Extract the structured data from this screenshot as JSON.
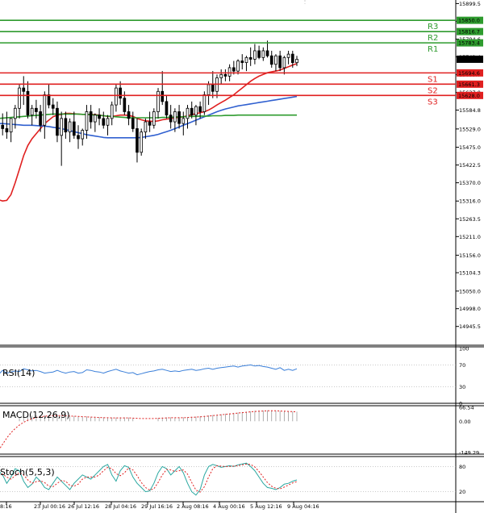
{
  "chart_data": {
    "type": "candlestick",
    "main": {
      "ylim": [
        14890,
        15910
      ],
      "yticks": [
        "15899.5",
        "15847.3",
        "15794.6",
        "15742.4",
        "15689.7",
        "15637.0",
        "15584.8",
        "15529.0",
        "15475.0",
        "15422.5",
        "15370.0",
        "15316.0",
        "15263.5",
        "15211.0",
        "15156.0",
        "15104.3",
        "15050.0",
        "14998.0",
        "14945.5"
      ],
      "price_label": {
        "value": 15735.0,
        "text": "15735.0"
      },
      "levels": [
        {
          "name": "R3",
          "value": 15850.0,
          "text": "15850.0",
          "color": "#2e9b2e"
        },
        {
          "name": "R2",
          "value": 15816.7,
          "text": "15816.7",
          "color": "#2e9b2e"
        },
        {
          "name": "R1",
          "value": 15783.4,
          "text": "15783.4",
          "color": "#2e9b2e"
        },
        {
          "name": "S1",
          "value": 15694.6,
          "text": "15694.6",
          "color": "#e02020"
        },
        {
          "name": "S2",
          "value": 15661.3,
          "text": "15661.3",
          "color": "#e02020"
        },
        {
          "name": "S3",
          "value": 15628.0,
          "text": "15628.0",
          "color": "#e02020"
        }
      ],
      "candles": [
        {
          "o": 15482,
          "h": 15560,
          "l": 15440,
          "c": 15540
        },
        {
          "o": 15540,
          "h": 15575,
          "l": 15510,
          "c": 15530
        },
        {
          "o": 15530,
          "h": 15580,
          "l": 15500,
          "c": 15520
        },
        {
          "o": 15520,
          "h": 15560,
          "l": 15490,
          "c": 15560
        },
        {
          "o": 15560,
          "h": 15600,
          "l": 15530,
          "c": 15590
        },
        {
          "o": 15590,
          "h": 15660,
          "l": 15560,
          "c": 15650
        },
        {
          "o": 15650,
          "h": 15685,
          "l": 15600,
          "c": 15640
        },
        {
          "o": 15640,
          "h": 15670,
          "l": 15560,
          "c": 15570
        },
        {
          "o": 15570,
          "h": 15600,
          "l": 15540,
          "c": 15590
        },
        {
          "o": 15590,
          "h": 15615,
          "l": 15560,
          "c": 15580
        },
        {
          "o": 15580,
          "h": 15600,
          "l": 15520,
          "c": 15540
        },
        {
          "o": 15540,
          "h": 15640,
          "l": 15500,
          "c": 15630
        },
        {
          "o": 15630,
          "h": 15660,
          "l": 15590,
          "c": 15600
        },
        {
          "o": 15600,
          "h": 15620,
          "l": 15570,
          "c": 15590
        },
        {
          "o": 15590,
          "h": 15610,
          "l": 15490,
          "c": 15510
        },
        {
          "o": 15510,
          "h": 15580,
          "l": 15420,
          "c": 15560
        },
        {
          "o": 15560,
          "h": 15580,
          "l": 15500,
          "c": 15520
        },
        {
          "o": 15520,
          "h": 15560,
          "l": 15490,
          "c": 15550
        },
        {
          "o": 15550,
          "h": 15580,
          "l": 15500,
          "c": 15510
        },
        {
          "o": 15510,
          "h": 15540,
          "l": 15470,
          "c": 15500
        },
        {
          "o": 15500,
          "h": 15530,
          "l": 15480,
          "c": 15525
        },
        {
          "o": 15525,
          "h": 15600,
          "l": 15500,
          "c": 15580
        },
        {
          "o": 15580,
          "h": 15600,
          "l": 15530,
          "c": 15550
        },
        {
          "o": 15550,
          "h": 15575,
          "l": 15520,
          "c": 15570
        },
        {
          "o": 15570,
          "h": 15590,
          "l": 15540,
          "c": 15560
        },
        {
          "o": 15560,
          "h": 15580,
          "l": 15530,
          "c": 15540
        },
        {
          "o": 15540,
          "h": 15570,
          "l": 15510,
          "c": 15560
        },
        {
          "o": 15560,
          "h": 15610,
          "l": 15540,
          "c": 15600
        },
        {
          "o": 15600,
          "h": 15660,
          "l": 15580,
          "c": 15650
        },
        {
          "o": 15650,
          "h": 15670,
          "l": 15600,
          "c": 15620
        },
        {
          "o": 15620,
          "h": 15640,
          "l": 15570,
          "c": 15580
        },
        {
          "o": 15580,
          "h": 15600,
          "l": 15540,
          "c": 15560
        },
        {
          "o": 15560,
          "h": 15580,
          "l": 15520,
          "c": 15530
        },
        {
          "o": 15530,
          "h": 15560,
          "l": 15430,
          "c": 15460
        },
        {
          "o": 15460,
          "h": 15530,
          "l": 15450,
          "c": 15520
        },
        {
          "o": 15520,
          "h": 15560,
          "l": 15500,
          "c": 15550
        },
        {
          "o": 15550,
          "h": 15580,
          "l": 15520,
          "c": 15540
        },
        {
          "o": 15540,
          "h": 15590,
          "l": 15530,
          "c": 15580
        },
        {
          "o": 15580,
          "h": 15650,
          "l": 15560,
          "c": 15640
        },
        {
          "o": 15640,
          "h": 15700,
          "l": 15600,
          "c": 15610
        },
        {
          "o": 15610,
          "h": 15630,
          "l": 15560,
          "c": 15570
        },
        {
          "o": 15570,
          "h": 15600,
          "l": 15530,
          "c": 15550
        },
        {
          "o": 15550,
          "h": 15590,
          "l": 15520,
          "c": 15580
        },
        {
          "o": 15580,
          "h": 15600,
          "l": 15530,
          "c": 15545
        },
        {
          "o": 15545,
          "h": 15580,
          "l": 15510,
          "c": 15560
        },
        {
          "o": 15560,
          "h": 15600,
          "l": 15530,
          "c": 15590
        },
        {
          "o": 15590,
          "h": 15610,
          "l": 15560,
          "c": 15570
        },
        {
          "o": 15570,
          "h": 15600,
          "l": 15540,
          "c": 15595
        },
        {
          "o": 15595,
          "h": 15610,
          "l": 15560,
          "c": 15580
        },
        {
          "o": 15580,
          "h": 15640,
          "l": 15570,
          "c": 15630
        },
        {
          "o": 15630,
          "h": 15670,
          "l": 15600,
          "c": 15660
        },
        {
          "o": 15660,
          "h": 15700,
          "l": 15620,
          "c": 15640
        },
        {
          "o": 15640,
          "h": 15690,
          "l": 15620,
          "c": 15680
        },
        {
          "o": 15680,
          "h": 15705,
          "l": 15660,
          "c": 15690
        },
        {
          "o": 15690,
          "h": 15705,
          "l": 15670,
          "c": 15685
        },
        {
          "o": 15685,
          "h": 15720,
          "l": 15670,
          "c": 15710
        },
        {
          "o": 15710,
          "h": 15730,
          "l": 15690,
          "c": 15700
        },
        {
          "o": 15700,
          "h": 15735,
          "l": 15690,
          "c": 15730
        },
        {
          "o": 15730,
          "h": 15750,
          "l": 15705,
          "c": 15725
        },
        {
          "o": 15725,
          "h": 15745,
          "l": 15700,
          "c": 15740
        },
        {
          "o": 15740,
          "h": 15770,
          "l": 15715,
          "c": 15735
        },
        {
          "o": 15735,
          "h": 15780,
          "l": 15720,
          "c": 15760
        },
        {
          "o": 15760,
          "h": 15775,
          "l": 15735,
          "c": 15740
        },
        {
          "o": 15740,
          "h": 15770,
          "l": 15730,
          "c": 15760
        },
        {
          "o": 15760,
          "h": 15790,
          "l": 15740,
          "c": 15745
        },
        {
          "o": 15745,
          "h": 15760,
          "l": 15710,
          "c": 15720
        },
        {
          "o": 15720,
          "h": 15750,
          "l": 15700,
          "c": 15745
        },
        {
          "o": 15745,
          "h": 15760,
          "l": 15700,
          "c": 15710
        },
        {
          "o": 15710,
          "h": 15745,
          "l": 15690,
          "c": 15740
        },
        {
          "o": 15740,
          "h": 15760,
          "l": 15720,
          "c": 15750
        },
        {
          "o": 15750,
          "h": 15760,
          "l": 15710,
          "c": 15725
        },
        {
          "o": 15725,
          "h": 15745,
          "l": 15715,
          "c": 15735
        }
      ],
      "ma_series": [
        {
          "color": "#e02020",
          "values": [
            15320,
            15316,
            15318,
            15335,
            15370,
            15410,
            15450,
            15480,
            15500,
            15515,
            15530,
            15545,
            15555,
            15565,
            15570,
            15572,
            15575,
            15575,
            15574,
            15573,
            15572,
            15572,
            15572,
            15571,
            15570,
            15568,
            15566,
            15566,
            15568,
            15570,
            15570,
            15569,
            15566,
            15560,
            15556,
            15553,
            15552,
            15551,
            15553,
            15556,
            15558,
            15560,
            15562,
            15563,
            15565,
            15568,
            15571,
            15574,
            15577,
            15580,
            15585,
            15592,
            15600,
            15607,
            15614,
            15622,
            15630,
            15640,
            15650,
            15660,
            15670,
            15678,
            15685,
            15690,
            15695,
            15698,
            15700,
            15703,
            15708,
            15713,
            15718,
            15722
          ]
        },
        {
          "color": "#3060d0",
          "values": [
            15545,
            15545,
            15544,
            15543,
            15542,
            15541,
            15540,
            15540,
            15540,
            15539,
            15538,
            15537,
            15536,
            15534,
            15532,
            15530,
            15527,
            15524,
            15521,
            15518,
            15515,
            15512,
            15510,
            15508,
            15506,
            15504,
            15503,
            15503,
            15503,
            15503,
            15503,
            15503,
            15503,
            15503,
            15504,
            15506,
            15508,
            15510,
            15513,
            15517,
            15521,
            15525,
            15530,
            15535,
            15540,
            15545,
            15550,
            15555,
            15560,
            15565,
            15570,
            15575,
            15580,
            15584,
            15588,
            15591,
            15594,
            15597,
            15599,
            15601,
            15603,
            15605,
            15607,
            15609,
            15611,
            15613,
            15615,
            15617,
            15619,
            15621,
            15623,
            15625
          ]
        },
        {
          "color": "#2e9b2e",
          "values": [
            15560,
            15561,
            15562,
            15563,
            15564,
            15565,
            15566,
            15567,
            15568,
            15569,
            15570,
            15571,
            15572,
            15573,
            15573,
            15573,
            15573,
            15573,
            15573,
            15573,
            15572,
            15572,
            15571,
            15570,
            15569,
            15568,
            15567,
            15566,
            15565,
            15564,
            15563,
            15562,
            15562,
            15562,
            15562,
            15562,
            15562,
            15562,
            15562,
            15563,
            15563,
            15564,
            15564,
            15565,
            15565,
            15566,
            15566,
            15566,
            15567,
            15567,
            15567,
            15568,
            15568,
            15568,
            15569,
            15569,
            15569,
            15570,
            15570,
            15570,
            15570,
            15570,
            15570,
            15570,
            15570,
            15570,
            15570,
            15570,
            15570,
            15570,
            15570,
            15570
          ]
        }
      ]
    },
    "x_labels": [
      "8:16",
      "23 Jul 00:16",
      "26 Jul 12:16",
      "28 Jul 04:16",
      "29 Jul 16:16",
      "2 Aug 08:16",
      "4 Aug 00:16",
      "5 Aug 12:16",
      "9 Aug 04:16"
    ],
    "rsi": {
      "label": "RSI(14)",
      "ylim": [
        0,
        100
      ],
      "yticks": [
        "100",
        "70",
        "30",
        "0"
      ],
      "levels": [
        70,
        30
      ],
      "values": [
        52,
        60,
        55,
        57,
        59,
        58,
        63,
        61,
        59,
        60,
        58,
        55,
        56,
        57,
        60,
        57,
        55,
        57,
        58,
        55,
        56,
        61,
        60,
        58,
        57,
        55,
        58,
        60,
        62,
        59,
        57,
        55,
        56,
        52,
        54,
        56,
        58,
        59,
        61,
        62,
        60,
        58,
        59,
        58,
        60,
        61,
        62,
        60,
        61,
        63,
        64,
        62,
        64,
        65,
        66,
        67,
        68,
        66,
        68,
        69,
        70,
        68,
        69,
        67,
        66,
        64,
        62,
        65,
        60,
        62,
        60,
        63
      ]
    },
    "macd": {
      "label": "MACD(12,26,9)",
      "yticks": [
        "66.54",
        "0.00",
        "-149.29"
      ],
      "ylim": [
        -149.29,
        66.54
      ],
      "hist": [
        -10,
        -5,
        2,
        8,
        14,
        19,
        23,
        25,
        27,
        28,
        28,
        29,
        29,
        30,
        29,
        28,
        27,
        26,
        25,
        24,
        23,
        23,
        22,
        21,
        20,
        19,
        18,
        18,
        18,
        19,
        19,
        18,
        17,
        15,
        14,
        14,
        14,
        15,
        16,
        18,
        19,
        19,
        19,
        19,
        19,
        20,
        21,
        22,
        24,
        26,
        28,
        30,
        32,
        34,
        36,
        38,
        40,
        42,
        44,
        46,
        48,
        50,
        51,
        52,
        52,
        52,
        51,
        50,
        49,
        48,
        47,
        46
      ],
      "signal": [
        -140,
        -110,
        -80,
        -55,
        -35,
        -18,
        -5,
        5,
        12,
        18,
        22,
        24,
        26,
        27,
        27,
        27,
        26,
        25,
        24,
        23,
        22,
        21,
        20,
        19,
        18,
        17,
        17,
        16,
        16,
        16,
        16,
        16,
        15,
        14,
        13,
        13,
        13,
        13,
        14,
        15,
        16,
        17,
        17,
        17,
        17,
        18,
        19,
        20,
        21,
        23,
        25,
        27,
        29,
        31,
        33,
        35,
        37,
        39,
        41,
        43,
        45,
        47,
        48,
        49,
        50,
        50,
        50,
        49,
        48,
        47,
        46,
        45
      ]
    },
    "stoch": {
      "label": "Stoch(5,5,3)",
      "yticks": [
        "80",
        "20"
      ],
      "ylim": [
        0,
        100
      ],
      "levels": [
        80,
        20
      ],
      "k": [
        70,
        60,
        40,
        55,
        75,
        70,
        45,
        30,
        38,
        55,
        45,
        30,
        25,
        40,
        55,
        45,
        35,
        25,
        40,
        50,
        60,
        55,
        50,
        60,
        70,
        80,
        85,
        60,
        45,
        70,
        82,
        78,
        55,
        40,
        30,
        20,
        22,
        40,
        65,
        80,
        75,
        60,
        70,
        80,
        65,
        40,
        20,
        12,
        25,
        60,
        80,
        85,
        82,
        78,
        80,
        82,
        80,
        84,
        86,
        88,
        80,
        70,
        55,
        40,
        30,
        28,
        25,
        30,
        38,
        40,
        45,
        48
      ],
      "d": [
        65,
        62,
        55,
        50,
        58,
        66,
        60,
        48,
        40,
        44,
        46,
        42,
        33,
        32,
        40,
        47,
        45,
        35,
        33,
        38,
        50,
        55,
        55,
        55,
        60,
        70,
        78,
        75,
        63,
        58,
        65,
        77,
        72,
        58,
        42,
        30,
        24,
        27,
        42,
        60,
        73,
        72,
        68,
        70,
        72,
        62,
        42,
        24,
        19,
        32,
        55,
        75,
        82,
        81,
        80,
        80,
        81,
        82,
        84,
        86,
        85,
        79,
        68,
        55,
        42,
        33,
        28,
        27,
        31,
        36,
        41,
        44
      ]
    }
  }
}
